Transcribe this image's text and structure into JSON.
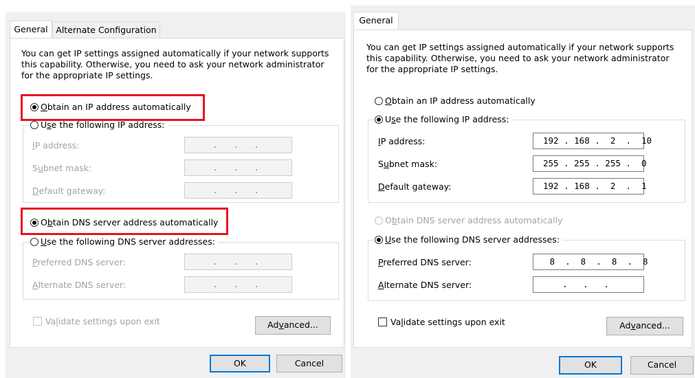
{
  "left_dialog": {
    "tabs": [
      "General",
      "Alternate Configuration"
    ],
    "info_line1": "You can get IP settings assigned automatically if your network supports",
    "info_line2": "this capability. Otherwise, you need to ask your network administrator",
    "info_line3": "for the appropriate IP settings.",
    "ip_auto": {
      "prefix": "",
      "underline": "O",
      "rest": "btain an IP address automatically",
      "selected": true
    },
    "ip_manual": {
      "prefix": "U",
      "underline": "s",
      "rest": "e the following IP address:",
      "selected": false
    },
    "ip_address": {
      "prefix": "",
      "underline": "I",
      "rest": "P address:",
      "value": ".   .   ."
    },
    "subnet": {
      "prefix": "S",
      "underline": "u",
      "rest": "bnet mask:",
      "value": ".   .   ."
    },
    "gateway": {
      "prefix": "",
      "underline": "D",
      "rest": "efault gateway:",
      "value": ".   .   ."
    },
    "dns_auto": {
      "prefix": "O",
      "underline": "b",
      "rest": "tain DNS server address automatically",
      "selected": true
    },
    "dns_manual": {
      "prefix": "",
      "underline": "U",
      "rest": "se the following DNS server addresses:",
      "selected": false
    },
    "preferred_dns": {
      "prefix": "",
      "underline": "P",
      "rest": "referred DNS server:",
      "value": ".   .   ."
    },
    "alternate_dns": {
      "prefix": "",
      "underline": "A",
      "rest": "lternate DNS server:",
      "value": ".   .   ."
    },
    "validate": {
      "prefix": "Va",
      "underline": "l",
      "rest": "idate settings upon exit",
      "checked": false
    },
    "advanced": {
      "prefix": "Ad",
      "underline": "v",
      "rest": "anced..."
    },
    "ok": "OK",
    "cancel": "Cancel"
  },
  "right_dialog": {
    "tabs": [
      "General"
    ],
    "info_line1": "You can get IP settings assigned automatically if your network supports",
    "info_line2": "this capability. Otherwise, you need to ask your network administrator",
    "info_line3": "for the appropriate IP settings.",
    "ip_auto": {
      "prefix": "",
      "underline": "O",
      "rest": "btain an IP address automatically",
      "selected": false
    },
    "ip_manual": {
      "prefix": "U",
      "underline": "s",
      "rest": "e the following IP address:",
      "selected": true
    },
    "ip_address": {
      "prefix": "",
      "underline": "I",
      "rest": "P address:",
      "value": "192 . 168 .  2  .  10"
    },
    "subnet": {
      "prefix": "S",
      "underline": "u",
      "rest": "bnet mask:",
      "value": "255 . 255 . 255 .  0"
    },
    "gateway": {
      "prefix": "",
      "underline": "D",
      "rest": "efault gateway:",
      "value": "192 . 168 .  2  .  1"
    },
    "dns_auto": {
      "prefix": "O",
      "underline": "b",
      "rest": "tain DNS server address automatically",
      "selected": false
    },
    "dns_manual": {
      "prefix": "",
      "underline": "U",
      "rest": "se the following DNS server addresses:",
      "selected": true
    },
    "preferred_dns": {
      "prefix": "",
      "underline": "P",
      "rest": "referred DNS server:",
      "value": " 8  .  8  .  8  .  8"
    },
    "alternate_dns": {
      "prefix": "",
      "underline": "A",
      "rest": "lternate DNS server:",
      "value": ".   .   ."
    },
    "validate": {
      "prefix": "Va",
      "underline": "l",
      "rest": "idate settings upon exit",
      "checked": false
    },
    "advanced": {
      "prefix": "Ad",
      "underline": "v",
      "rest": "anced..."
    },
    "ok": "OK",
    "cancel": "Cancel"
  },
  "colors": {
    "highlight": "#e81123",
    "default_button": "#0078d7",
    "dialog_bg": "#f0f0f0"
  }
}
